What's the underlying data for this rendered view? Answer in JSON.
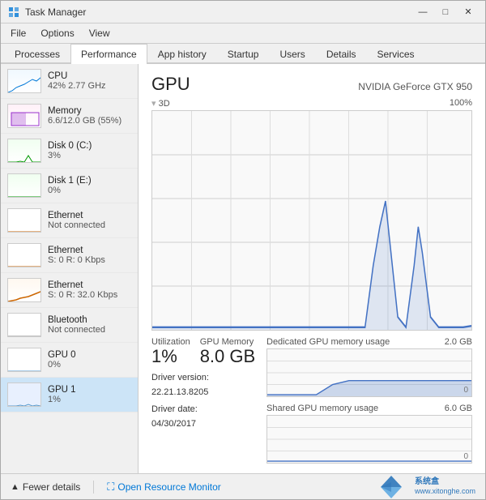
{
  "window": {
    "title": "Task Manager",
    "controls": [
      "minimize",
      "maximize",
      "close"
    ]
  },
  "menu": {
    "items": [
      "File",
      "Options",
      "View"
    ]
  },
  "tabs": {
    "items": [
      "Processes",
      "Performance",
      "App history",
      "Startup",
      "Users",
      "Details",
      "Services"
    ],
    "active": "Performance"
  },
  "sidebar": {
    "items": [
      {
        "id": "cpu",
        "name": "CPU",
        "value": "42% 2.77 GHz",
        "thumb": "cpu"
      },
      {
        "id": "memory",
        "name": "Memory",
        "value": "6.6/12.0 GB (55%)",
        "thumb": "memory"
      },
      {
        "id": "disk0",
        "name": "Disk 0 (C:)",
        "value": "3%",
        "thumb": "disk0"
      },
      {
        "id": "disk1",
        "name": "Disk 1 (E:)",
        "value": "0%",
        "thumb": "disk1"
      },
      {
        "id": "eth1",
        "name": "Ethernet",
        "value": "Not connected",
        "thumb": "eth1"
      },
      {
        "id": "eth2",
        "name": "Ethernet",
        "value": "S: 0  R: 0 Kbps",
        "thumb": "eth2"
      },
      {
        "id": "eth3",
        "name": "Ethernet",
        "value": "S: 0  R: 32.0 Kbps",
        "thumb": "eth3"
      },
      {
        "id": "bluetooth",
        "name": "Bluetooth",
        "value": "Not connected",
        "thumb": "bt"
      },
      {
        "id": "gpu0",
        "name": "GPU 0",
        "value": "0%",
        "thumb": "gpu0"
      },
      {
        "id": "gpu1",
        "name": "GPU 1",
        "value": "1%",
        "thumb": "gpu1",
        "active": true
      }
    ]
  },
  "main": {
    "title": "GPU",
    "device_name": "NVIDIA GeForce GTX 950",
    "graph_section_label": "3D",
    "graph_max": "100%",
    "utilization_label": "Utilization",
    "utilization_value": "1%",
    "gpu_memory_label": "GPU Memory",
    "gpu_memory_value": "8.0 GB",
    "driver_version_label": "Driver version:",
    "driver_version_value": "22.21.13.8205",
    "driver_date_label": "Driver date:",
    "driver_date_value": "04/30/2017",
    "dedicated_label": "Dedicated GPU memory usage",
    "dedicated_max": "2.0 GB",
    "dedicated_min": "0",
    "shared_label": "Shared GPU memory usage",
    "shared_max": "6.0 GB",
    "shared_min": "0"
  },
  "footer": {
    "fewer_details_label": "Fewer details",
    "monitor_label": "Open Resource Monitor"
  }
}
